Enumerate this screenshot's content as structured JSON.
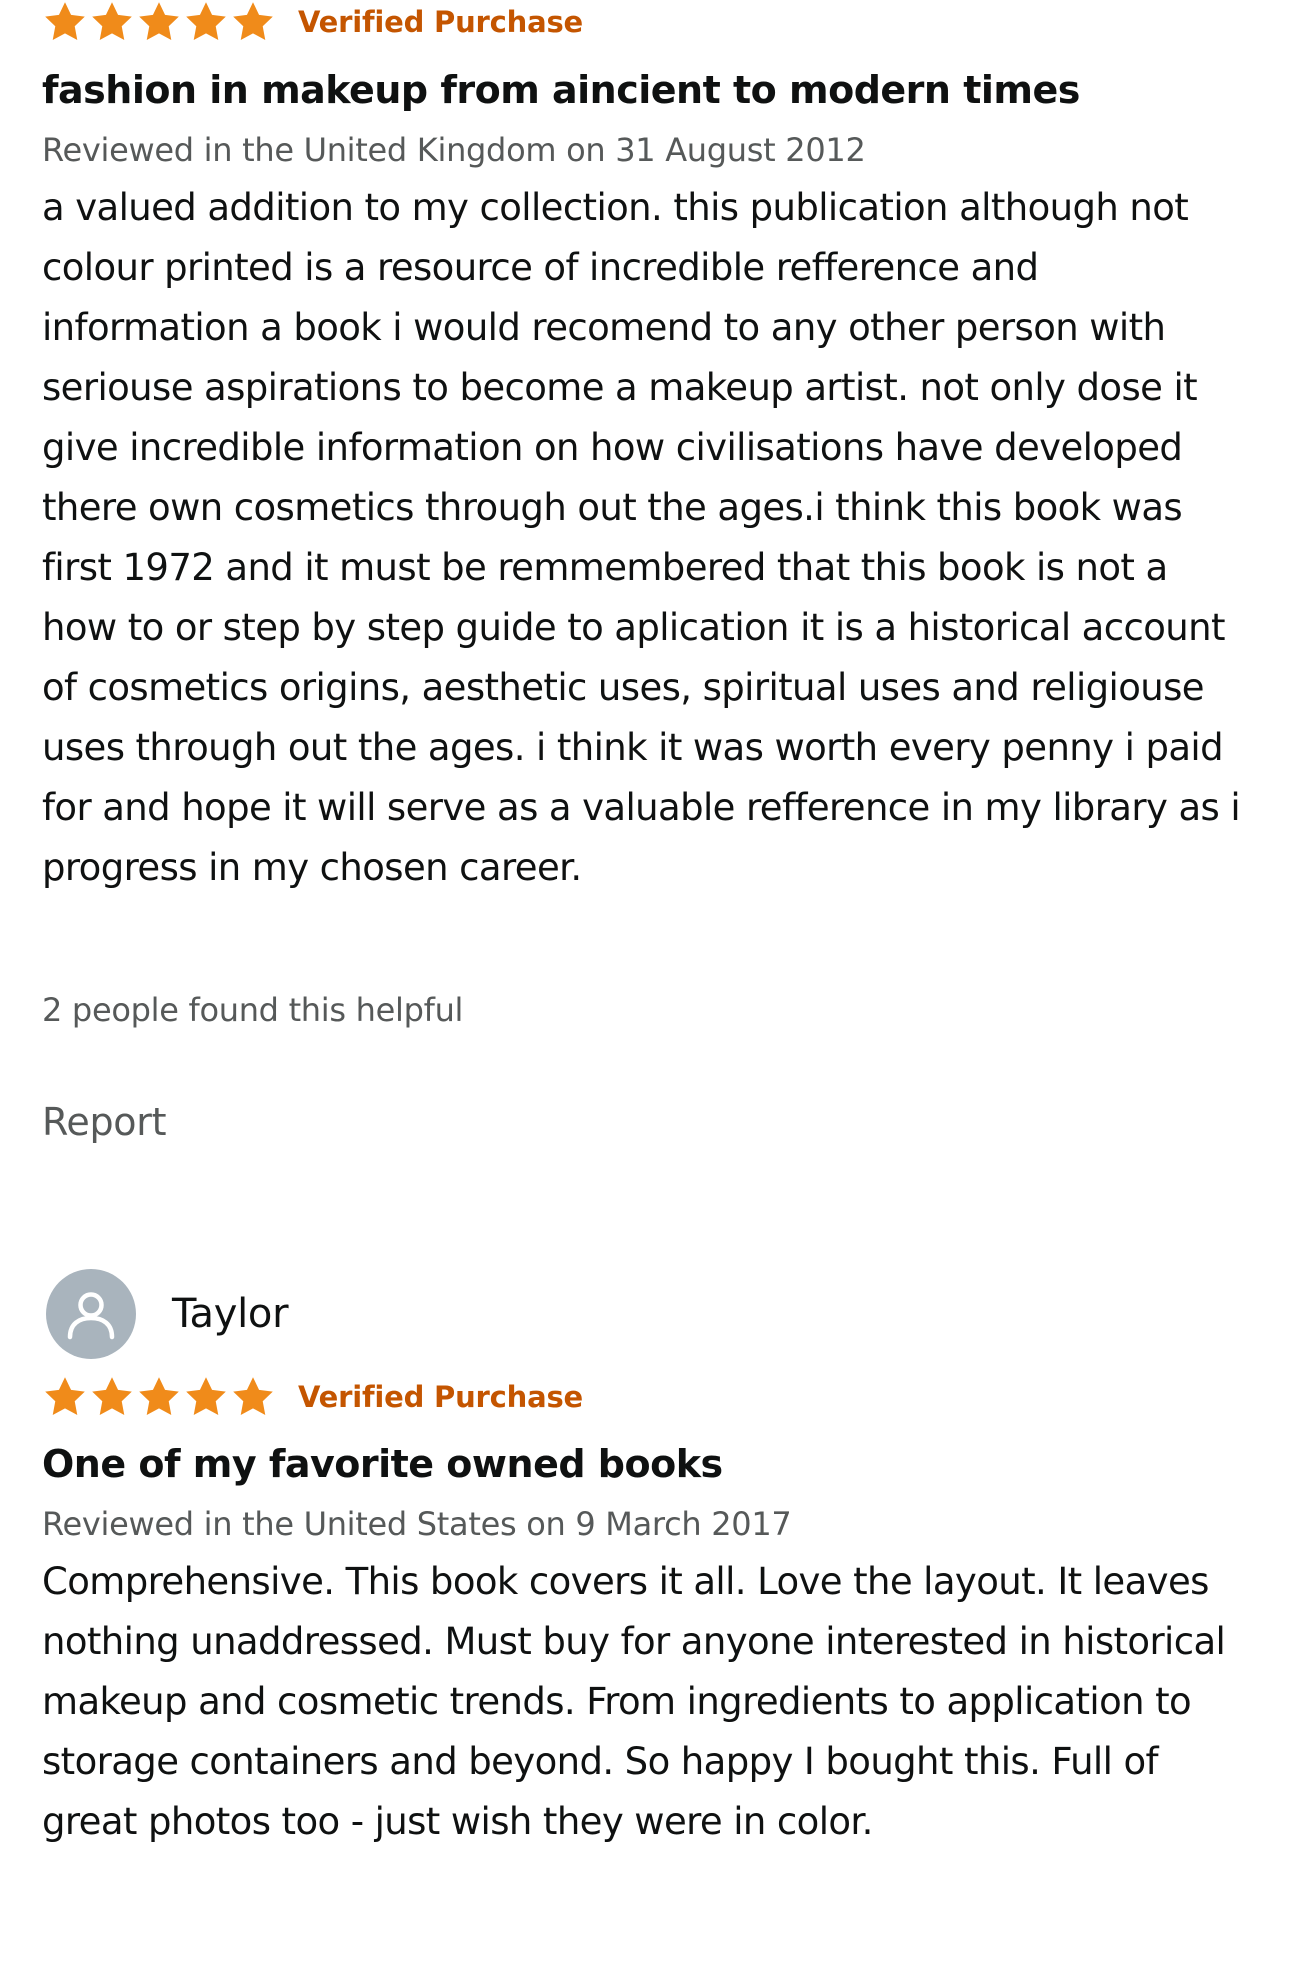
{
  "colors": {
    "star": "#f08b1a",
    "verified": "#c45500",
    "meta": "#565959",
    "text": "#0f1111",
    "avatar_bg": "#a9b4bd"
  },
  "reviews": [
    {
      "rating": 5,
      "max_rating": 5,
      "verified_label": "Verified Purchase",
      "title": "fashion in makeup from aincient to modern times",
      "meta": "Reviewed in the United Kingdom on 31 August 2012",
      "body": "a valued addition to my collection. this publication although not colour printed is a resource of incredible refference and information a book i would recomend to any other person with seriouse aspirations to become a makeup artist. not only dose it give incredible information on how civilisations have developed there own cosmetics through out the ages.i think this book was first 1972 and it must be remmembered that this book is not a how to or step by step guide to aplication it is a historical account of cosmetics origins, aesthetic uses, spiritual uses and religiouse uses through out the ages. i think it was worth every penny i paid for and hope it will serve as a valuable refference in my library as i progress in my chosen career.",
      "helpful": "2 people found this helpful",
      "report_label": "Report"
    },
    {
      "reviewer": {
        "name": "Taylor",
        "avatar_icon": "default-user-icon"
      },
      "rating": 5,
      "max_rating": 5,
      "verified_label": "Verified Purchase",
      "title": "One of my favorite owned books",
      "meta": "Reviewed in the United States on 9 March 2017",
      "body": "Comprehensive. This book covers it all. Love the layout. It leaves nothing unaddressed. Must buy for anyone interested in historical makeup and cosmetic trends. From ingredients to application to storage containers and beyond. So happy I bought this. Full of great photos too - just wish they were in color."
    }
  ]
}
